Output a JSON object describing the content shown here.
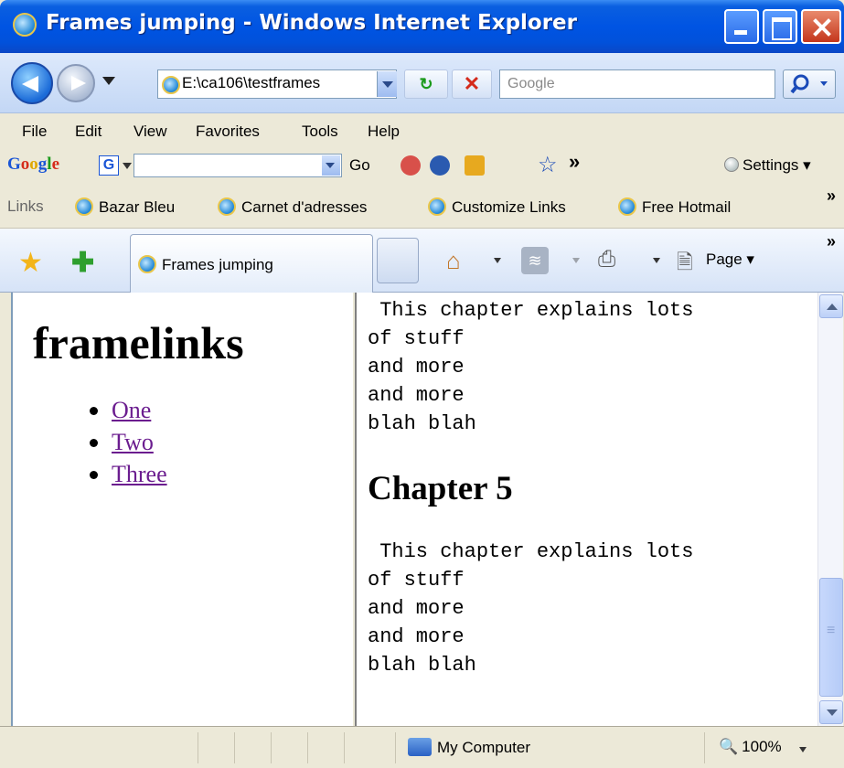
{
  "window": {
    "title": "Frames jumping - Windows Internet Explorer"
  },
  "address_bar": {
    "url": "E:\\ca106\\testframes",
    "search_placeholder": "Google"
  },
  "menu": {
    "items": [
      "File",
      "Edit",
      "View",
      "Favorites",
      "Tools",
      "Help"
    ]
  },
  "google_toolbar": {
    "logo": "Google",
    "g_button": "G",
    "go_label": "Go",
    "settings_label": "Settings"
  },
  "links_bar": {
    "label": "Links",
    "items": [
      "Bazar Bleu",
      "Carnet d'adresses",
      "Customize Links",
      "Free Hotmail"
    ]
  },
  "tabs": {
    "active_tab": "Frames jumping",
    "page_label": "Page"
  },
  "left_frame": {
    "heading": "framelinks",
    "links": [
      "One",
      "Two",
      "Three"
    ]
  },
  "right_frame": {
    "pre_top": " This chapter explains lots\nof stuff\nand more\nand more\nblah blah",
    "chapter_heading": "Chapter 5",
    "pre_bottom": " This chapter explains lots\nof stuff\nand more\nand more\nblah blah"
  },
  "status_bar": {
    "zone": "My Computer",
    "zoom": "100%"
  },
  "icons": {
    "back": "back-arrow-icon",
    "forward": "forward-arrow-icon",
    "refresh": "refresh-icon",
    "stop": "stop-icon",
    "search": "magnifier-icon",
    "favorites": "star-icon",
    "add_favorite": "add-favorite-icon",
    "home": "home-icon",
    "feeds": "rss-feed-icon",
    "print": "printer-icon",
    "page": "page-icon"
  }
}
